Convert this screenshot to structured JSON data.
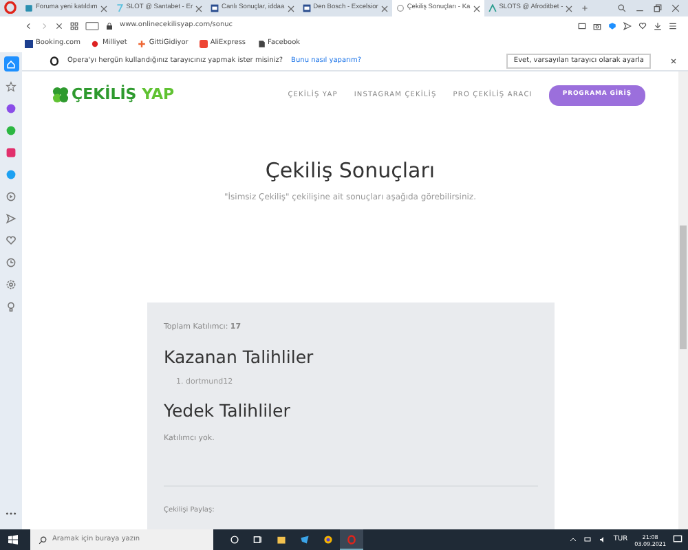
{
  "browser": {
    "tabs": [
      {
        "title": "Foruma yeni katıldım",
        "kind": "forum",
        "selected": false
      },
      {
        "title": "SLOT @ Santabet - Er",
        "kind": "slot",
        "selected": false
      },
      {
        "title": "Canlı Sonuçlar, iddaa",
        "kind": "news",
        "selected": false
      },
      {
        "title": "Den Bosch - Excelsior",
        "kind": "news",
        "selected": false
      },
      {
        "title": "Çekiliş Sonuçları - Ka",
        "kind": "loading",
        "selected": true
      },
      {
        "title": "SLOTS @ Afroditbet -",
        "kind": "afrodit",
        "selected": false
      }
    ],
    "url": "www.onlinecekilisyap.com/sonuc",
    "bookmarks": [
      {
        "label": "Booking.com",
        "kind": "booking"
      },
      {
        "label": "Milliyet",
        "kind": "milliyet"
      },
      {
        "label": "GittiGidiyor",
        "kind": "gg"
      },
      {
        "label": "AliExpress",
        "kind": "ali"
      },
      {
        "label": "Facebook",
        "kind": "doc"
      }
    ],
    "infobar": {
      "message": "Opera'yı hergün kullandığınız tarayıcınız yapmak ister misiniz?",
      "link": "Bunu nasıl yaparım?",
      "button": "Evet, varsayılan tarayıcı olarak ayarla"
    },
    "sidebar": [
      {
        "kind": "home",
        "selected": true
      },
      {
        "kind": "star",
        "selected": false
      },
      {
        "kind": "messenger",
        "selected": false
      },
      {
        "kind": "whatsapp",
        "selected": false
      },
      {
        "kind": "instagram",
        "selected": false
      },
      {
        "kind": "twitter",
        "selected": false
      },
      {
        "kind": "player",
        "selected": false
      },
      {
        "kind": "send",
        "selected": false
      },
      {
        "kind": "heart",
        "selected": false
      },
      {
        "kind": "clock",
        "selected": false
      },
      {
        "kind": "settings",
        "selected": false
      },
      {
        "kind": "bulb",
        "selected": false
      }
    ]
  },
  "site": {
    "logo": {
      "word1": "ÇEKİLİŞ",
      "word2": "YAP"
    },
    "nav": [
      "ÇEKİLİŞ YAP",
      "INSTAGRAM ÇEKİLİŞ",
      "PRO ÇEKİLİŞ ARACI"
    ],
    "cta": "PROGRAMA GİRİŞ",
    "title": "Çekiliş Sonuçları",
    "subtitle": "\"İsimsiz Çekiliş\" çekilişine ait sonuçları aşağıda görebilirsiniz.",
    "results": {
      "total": "Toplam Katılımcı: **17**",
      "winners_heading": "Kazanan Talihliler",
      "winners": [
        {
          "number": "1.",
          "name": "dortmund12"
        }
      ],
      "backups_heading": "Yedek Talihliler",
      "backups_empty": "Katılımcı yok.",
      "share_label": "Çekilişi Paylaş:"
    }
  },
  "taskbar": {
    "search_placeholder": "Aramak için buraya yazın",
    "apps": [
      {
        "kind": "cortana",
        "active": false
      },
      {
        "kind": "taskview",
        "active": false
      },
      {
        "kind": "explorer",
        "active": false
      },
      {
        "kind": "store",
        "active": false
      },
      {
        "kind": "chrome",
        "active": false
      },
      {
        "kind": "opera",
        "active": true
      }
    ],
    "language": "TUR",
    "time": "21:08",
    "date": "03.09.2021"
  }
}
